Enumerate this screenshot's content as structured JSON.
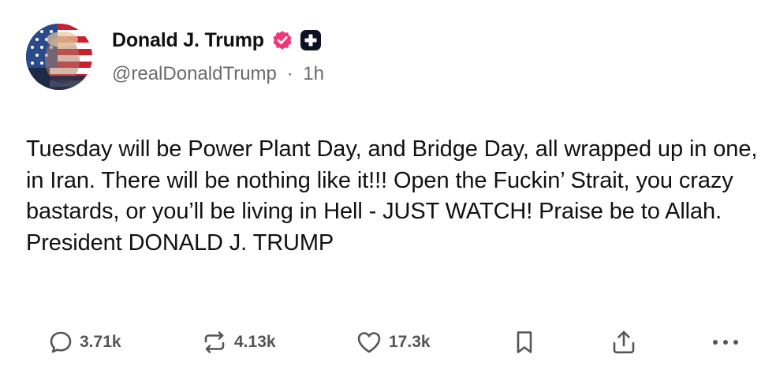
{
  "author": {
    "display_name": "Donald J. Trump",
    "handle": "@realDonaldTrump",
    "separator": "·",
    "time_ago": "1h",
    "verified_color": "#f0357a"
  },
  "post": {
    "text": "Tuesday will be Power Plant Day, and Bridge Day, all wrapped up in one, in Iran. There will be nothing like it!!! Open the Fuckin’ Strait, you crazy bastards, or you’ll be living in Hell - JUST WATCH! Praise be to Allah. President DONALD J. TRUMP"
  },
  "actions": {
    "replies": "3.71k",
    "reposts": "4.13k",
    "likes": "17.3k",
    "icons": [
      "comment-icon",
      "repost-icon",
      "heart-icon",
      "bookmark-icon",
      "share-icon",
      "more-icon"
    ],
    "icon_color": "#555555"
  }
}
